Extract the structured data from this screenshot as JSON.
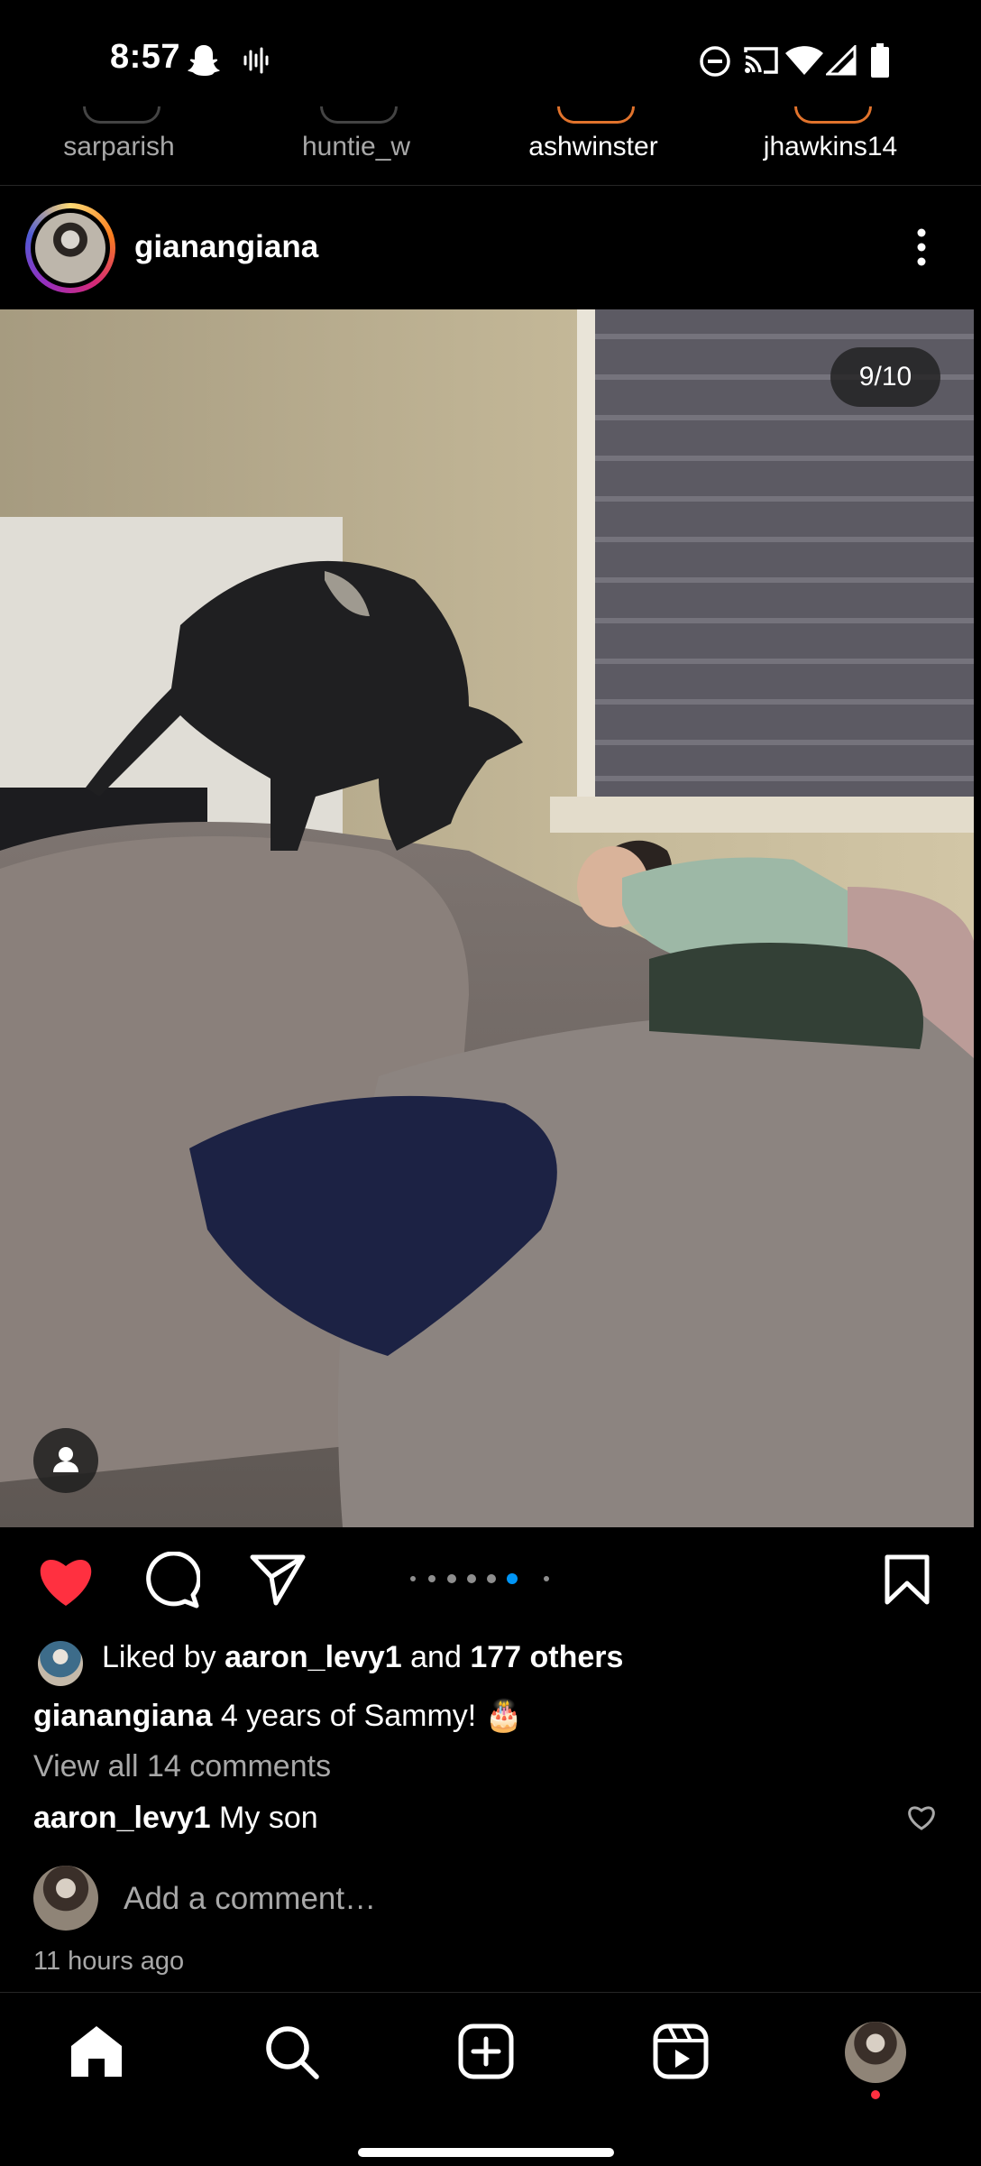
{
  "status_bar": {
    "time": "8:57",
    "left_icons": [
      "snapchat-icon",
      "voice-wave-icon"
    ],
    "right_icons": [
      "do-not-disturb-icon",
      "cast-icon",
      "wifi-icon",
      "signal-icon",
      "battery-icon"
    ]
  },
  "stories": [
    {
      "name": "sarparish"
    },
    {
      "name": "huntie_w"
    },
    {
      "name": "ashwinster"
    },
    {
      "name": "jhawkins14"
    }
  ],
  "post": {
    "username": "gianangiana",
    "media_counter": "9/10",
    "carousel_total": 7,
    "carousel_active": 6,
    "liked_by_prefix": "Liked by",
    "liked_by_user": "aaron_levy1",
    "liked_by_and": "and",
    "liked_by_others": "177 others",
    "caption_user": "gianangiana",
    "caption_text": "4 years of Sammy! 🎂",
    "view_comments": "View all 14 comments",
    "top_comment_user": "aaron_levy1",
    "top_comment_text": "My son",
    "add_comment_placeholder": "Add a comment…",
    "timestamp": "11 hours ago",
    "liked": true
  },
  "colors": {
    "like_red": "#ff3040",
    "active_dot_blue": "#0095f6",
    "secondary_text": "#a8a8a8"
  },
  "bottom_nav": [
    "home-icon",
    "search-icon",
    "create-icon",
    "reels-icon",
    "profile-avatar"
  ]
}
